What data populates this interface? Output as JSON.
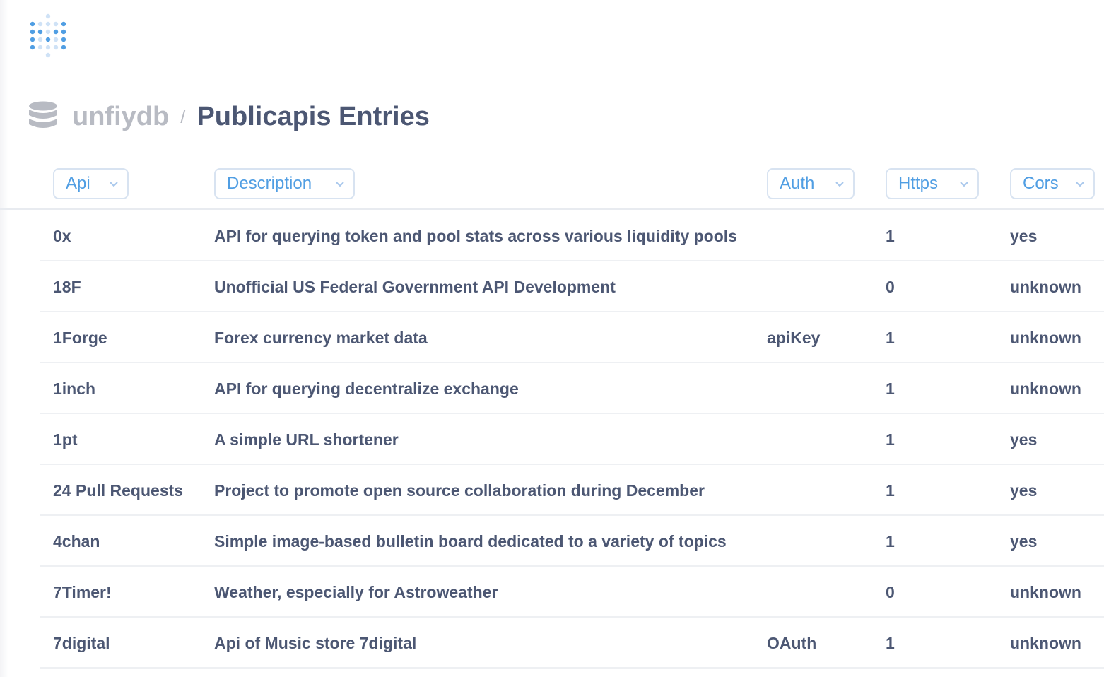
{
  "breadcrumb": {
    "database": "unfiydb",
    "separator": "/",
    "title": "Publicapis Entries"
  },
  "icons": {
    "logo": "metabase-logo-icon",
    "database": "database-icon",
    "column_menu": "chevron-down-icon"
  },
  "colors": {
    "accent": "#509ee3",
    "text": "#4c5773",
    "muted": "#b8bbc3"
  },
  "table": {
    "columns": [
      {
        "key": "api",
        "label": "Api"
      },
      {
        "key": "description",
        "label": "Description"
      },
      {
        "key": "auth",
        "label": "Auth"
      },
      {
        "key": "https",
        "label": "Https"
      },
      {
        "key": "cors",
        "label": "Cors"
      }
    ],
    "rows": [
      {
        "api": "0x",
        "description": "API for querying token and pool stats across various liquidity pools",
        "auth": "",
        "https": "1",
        "cors": "yes"
      },
      {
        "api": "18F",
        "description": "Unofficial US Federal Government API Development",
        "auth": "",
        "https": "0",
        "cors": "unknown"
      },
      {
        "api": "1Forge",
        "description": "Forex currency market data",
        "auth": "apiKey",
        "https": "1",
        "cors": "unknown"
      },
      {
        "api": "1inch",
        "description": "API for querying decentralize exchange",
        "auth": "",
        "https": "1",
        "cors": "unknown"
      },
      {
        "api": "1pt",
        "description": "A simple URL shortener",
        "auth": "",
        "https": "1",
        "cors": "yes"
      },
      {
        "api": "24 Pull Requests",
        "description": "Project to promote open source collaboration during December",
        "auth": "",
        "https": "1",
        "cors": "yes"
      },
      {
        "api": "4chan",
        "description": "Simple image-based bulletin board dedicated to a variety of topics",
        "auth": "",
        "https": "1",
        "cors": "yes"
      },
      {
        "api": "7Timer!",
        "description": "Weather, especially for Astroweather",
        "auth": "",
        "https": "0",
        "cors": "unknown"
      },
      {
        "api": "7digital",
        "description": "Api of Music store 7digital",
        "auth": "OAuth",
        "https": "1",
        "cors": "unknown"
      }
    ]
  }
}
